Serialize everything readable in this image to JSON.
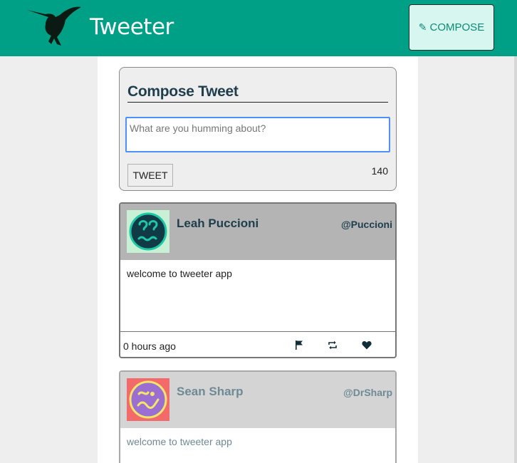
{
  "nav": {
    "brand": "Tweeter",
    "compose_icon": "✎",
    "compose_label": "COMPOSE",
    "logo_icon": "hummingbird-icon"
  },
  "new_tweet": {
    "heading": "Compose Tweet",
    "placeholder": "What are you humming about?",
    "value": "",
    "submit_label": "TWEET",
    "counter": "140"
  },
  "tweets": [
    {
      "name": "Leah Puccioni",
      "handle": "@Puccioni",
      "text": "welcome to tweeter app",
      "timestamp": "0 hours ago",
      "avatar_color": "#c8f0d4",
      "actions": [
        "flag-icon",
        "retweet-icon",
        "heart-icon"
      ]
    },
    {
      "name": "Sean Sharp",
      "handle": "@DrSharp",
      "text": "welcome to tweeter app",
      "avatar_color": "#f26a6a"
    }
  ],
  "colors": {
    "navbar": "#00a087",
    "accent_text": "#1f3e4d",
    "compose_bg": "#d6f6ef"
  }
}
